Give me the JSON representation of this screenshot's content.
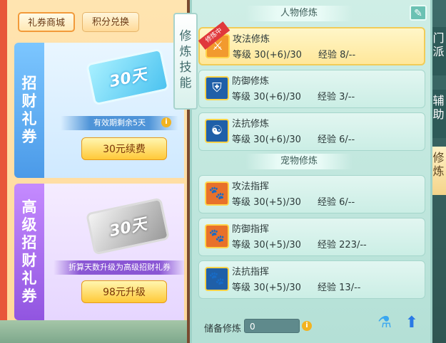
{
  "shop": {
    "tabs": [
      {
        "label": "礼券商城",
        "active": true
      },
      {
        "label": "积分兑换",
        "active": false
      }
    ],
    "cards": [
      {
        "label_chars": [
          "招",
          "财",
          "礼",
          "券"
        ],
        "ticket_text": "30天",
        "ribbon_text": "有效期剩余5天",
        "button_label": "30元续费",
        "info_glyph": "i"
      },
      {
        "label_chars": [
          "高",
          "级",
          "招",
          "财",
          "礼",
          "券"
        ],
        "ticket_text": "30天",
        "ribbon_text": "折算天数升级为高级招财礼券",
        "button_label": "98元升级"
      }
    ]
  },
  "vertical_tab": {
    "label_chars": [
      "修",
      "炼",
      "技",
      "能"
    ]
  },
  "side_tabs": [
    {
      "chars": [
        "门",
        "派"
      ]
    },
    {
      "chars": [
        "辅",
        "助"
      ]
    },
    {
      "chars": [
        "修",
        "炼"
      ]
    }
  ],
  "sections": {
    "character": "人物修炼",
    "pet": "宠物修炼"
  },
  "edit_icon": "pencil-icon",
  "character_skills": [
    {
      "name": "攻法修炼",
      "level_label": "等级",
      "level": "30(+6)/30",
      "exp_label": "经验",
      "exp": "8/--",
      "active": true,
      "icon": "sword-icon",
      "tag": "修炼中"
    },
    {
      "name": "防御修炼",
      "level_label": "等级",
      "level": "30(+6)/30",
      "exp_label": "经验",
      "exp": "3/--",
      "icon": "shield-icon"
    },
    {
      "name": "法抗修炼",
      "level_label": "等级",
      "level": "30(+6)/30",
      "exp_label": "经验",
      "exp": "6/--",
      "icon": "taiji-icon"
    }
  ],
  "pet_skills": [
    {
      "name": "攻法指挥",
      "level_label": "等级",
      "level": "30(+5)/30",
      "exp_label": "经验",
      "exp": "6/--",
      "icon": "paw-flag-icon"
    },
    {
      "name": "防御指挥",
      "level_label": "等级",
      "level": "30(+5)/30",
      "exp_label": "经验",
      "exp": "223/--",
      "icon": "paw-shield-icon"
    },
    {
      "name": "法抗指挥",
      "level_label": "等级",
      "level": "30(+5)/30",
      "exp_label": "经验",
      "exp": "13/--",
      "icon": "paw-orb-icon"
    }
  ],
  "footer": {
    "label": "储备修炼",
    "value": "0",
    "info_glyph": "i"
  }
}
